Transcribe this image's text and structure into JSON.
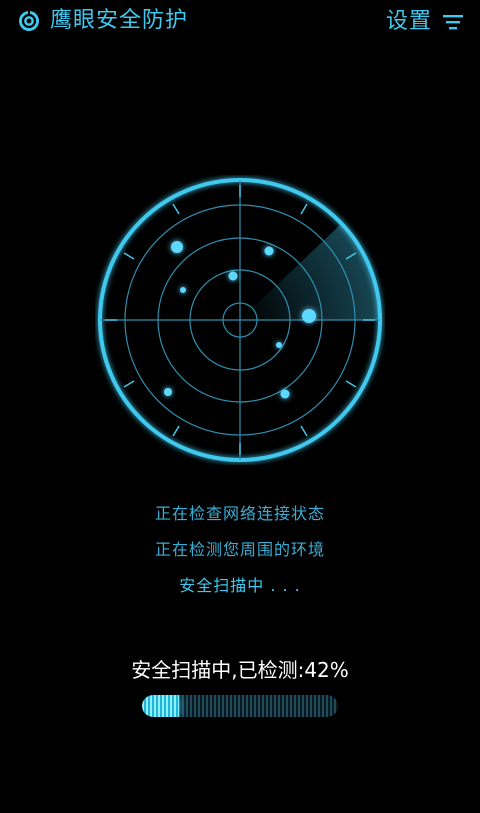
{
  "header": {
    "logo_icon": "eye-shield-icon",
    "title": "鹰眼安全防护",
    "settings_label": "设置",
    "menu_icon": "filter-menu-icon"
  },
  "radar": {
    "icon": "radar-scan-icon",
    "accent": "#41c8ee",
    "blip_count": 8
  },
  "status": {
    "lines": [
      "正在检查网络连接状态",
      "正在检测您周围的环境",
      "安全扫描中 . . ."
    ]
  },
  "progress": {
    "label": "安全扫描中,已检测:42%",
    "percent": 42
  },
  "colors": {
    "accent": "#41c8ee",
    "background": "#000000",
    "text": "#ffffff"
  }
}
